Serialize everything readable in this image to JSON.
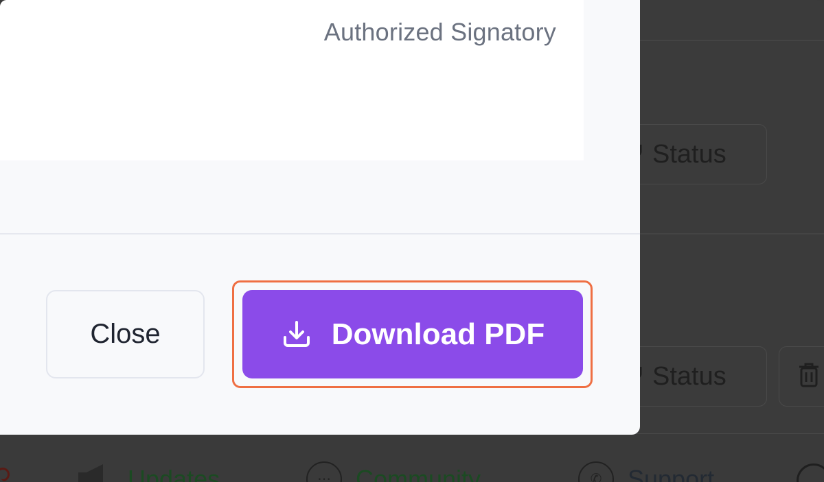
{
  "modal": {
    "signatory_label": "Authorized Signatory",
    "close_label": "Close",
    "download_label": "Download PDF",
    "icons": {
      "download": "download-icon"
    },
    "colors": {
      "primary": "#8b4be9",
      "highlight": "#ef6f43"
    }
  },
  "background": {
    "status_labels": [
      "Status",
      "Status"
    ],
    "nav": [
      {
        "label": "Updates",
        "icon": "megaphone-icon"
      },
      {
        "label": "Community",
        "icon": "chat-bubble-icon"
      },
      {
        "label": "Support",
        "icon": "whatsapp-icon"
      }
    ]
  }
}
